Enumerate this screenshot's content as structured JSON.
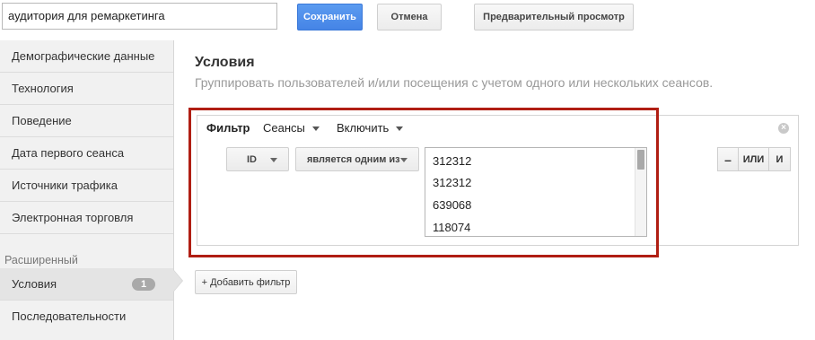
{
  "header": {
    "audience_name": "аудитория для ремаркетинга",
    "save_label": "Сохранить",
    "cancel_label": "Отмена",
    "preview_label": "Предварительный просмотр"
  },
  "sidebar": {
    "items": [
      {
        "label": "Демографические данные"
      },
      {
        "label": "Технология"
      },
      {
        "label": "Поведение"
      },
      {
        "label": "Дата первого сеанса"
      },
      {
        "label": "Источники трафика"
      },
      {
        "label": "Электронная торговля"
      }
    ],
    "section_label": "Расширенный",
    "advanced_items": [
      {
        "label": "Условия",
        "badge": "1"
      },
      {
        "label": "Последовательности"
      }
    ]
  },
  "main": {
    "title": "Условия",
    "subtitle": "Группировать пользователей и/или посещения с учетом одного или нескольких сеансов.",
    "filter": {
      "label": "Фильтр",
      "scope": "Сеансы",
      "mode": "Включить",
      "dimension": "ID",
      "operator": "является одним из",
      "values": [
        "312312",
        "312312",
        "639068",
        "118074"
      ],
      "minus_label": "–",
      "or_label": "ИЛИ",
      "and_label": "И",
      "close_icon": "close-icon"
    },
    "add_filter_label": "+ Добавить фильтр"
  },
  "colors": {
    "save_button": "#4584e6",
    "highlight": "#b01e13",
    "sidebar_bg": "#f1f1f1"
  }
}
